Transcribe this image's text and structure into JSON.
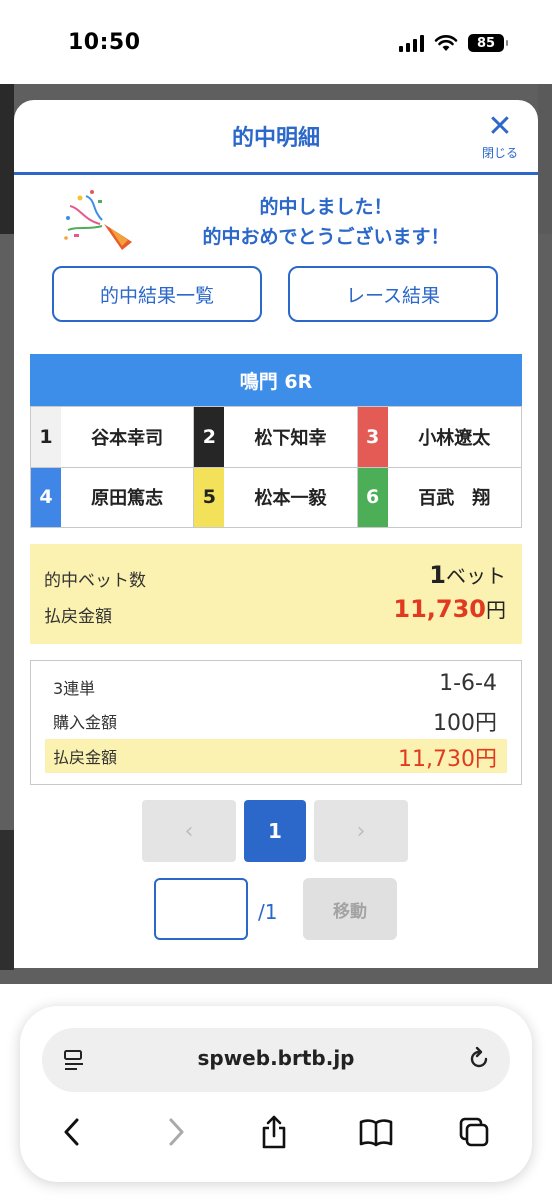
{
  "status": {
    "time": "10:50",
    "battery": "85"
  },
  "modal": {
    "title": "的中明細",
    "close_label": "閉じる",
    "congrats_line1": "的中しました！",
    "congrats_line2": "的中おめでとうございます！",
    "buttons": {
      "hit_list": "的中結果一覧",
      "race_result": "レース結果"
    }
  },
  "race": {
    "name": "鳴門 6R",
    "racers": [
      {
        "lane": "1",
        "name": "谷本幸司",
        "lane_bg": "#f1f1f1",
        "lane_fg": "#222222"
      },
      {
        "lane": "2",
        "name": "松下知幸",
        "lane_bg": "#262626",
        "lane_fg": "#ffffff"
      },
      {
        "lane": "3",
        "name": "小林遼太",
        "lane_bg": "#e45a55",
        "lane_fg": "#ffffff"
      },
      {
        "lane": "4",
        "name": "原田篤志",
        "lane_bg": "#3f86e6",
        "lane_fg": "#ffffff"
      },
      {
        "lane": "5",
        "name": "松本一毅",
        "lane_bg": "#f4e15a",
        "lane_fg": "#222222"
      },
      {
        "lane": "6",
        "name": "百武　翔",
        "lane_bg": "#4cae57",
        "lane_fg": "#ffffff"
      }
    ]
  },
  "summary": {
    "hit_bets_label": "的中ベット数",
    "hit_bets_value": "1",
    "hit_bets_unit": "ベット",
    "payout_label": "払戻金額",
    "payout_value": "11,730",
    "payout_unit": "円"
  },
  "detail": {
    "bet_type": "3連単",
    "combination": "1-6-4",
    "purchase_label": "購入金額",
    "purchase_value": "100円",
    "payout_label": "払戻金額",
    "payout_value": "11,730円"
  },
  "pagination": {
    "prev": "‹",
    "current": "1",
    "next": "›",
    "total": "/1",
    "move_label": "移動",
    "input_value": ""
  },
  "browser": {
    "url": "spweb.brtb.jp"
  },
  "colors": {
    "accent": "#2b68c9",
    "race_bar": "#3d8ee8",
    "highlight": "#fbf1b0",
    "payout_red": "#e03a21"
  }
}
